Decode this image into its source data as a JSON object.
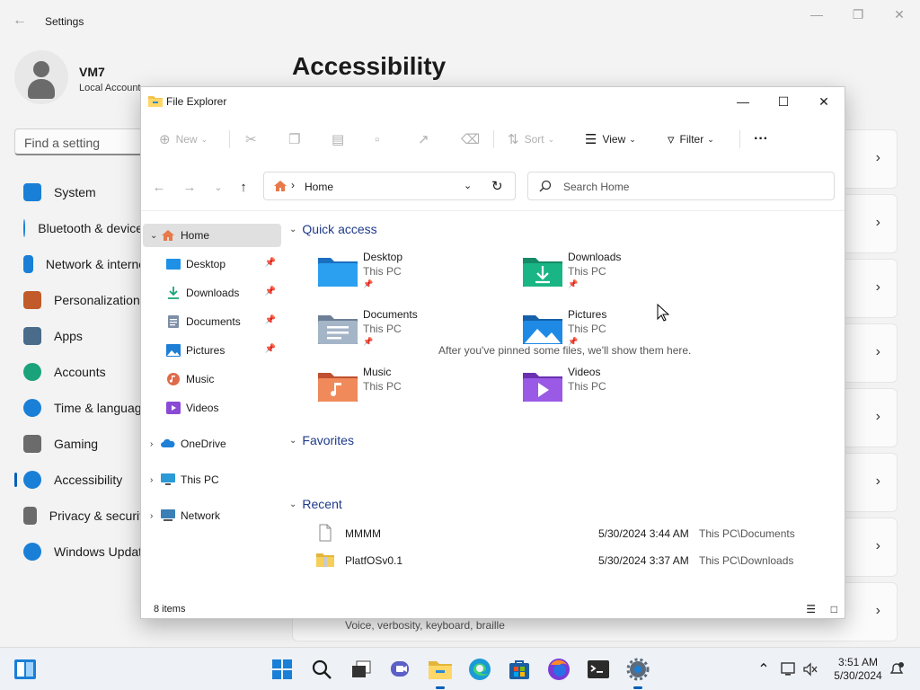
{
  "settings": {
    "title": "Settings",
    "user_name": "VM7",
    "account_type": "Local Account",
    "search_placeholder": "Find a setting",
    "heading": "Accessibility",
    "nav": [
      {
        "label": "System",
        "color": "#1a7fd6"
      },
      {
        "label": "Bluetooth & devices",
        "color": "#1a7fd6"
      },
      {
        "label": "Network & internet",
        "color": "#1a7fd6"
      },
      {
        "label": "Personalization",
        "color": "#c15b2a"
      },
      {
        "label": "Apps",
        "color": "#4a6b8a"
      },
      {
        "label": "Accounts",
        "color": "#1aa37a"
      },
      {
        "label": "Time & language",
        "color": "#1a7fd6"
      },
      {
        "label": "Gaming",
        "color": "#6b6b6b"
      },
      {
        "label": "Accessibility",
        "color": "#1a7fd6"
      },
      {
        "label": "Privacy & security",
        "color": "#6b6b6b"
      },
      {
        "label": "Windows Update",
        "color": "#1a7fd6"
      }
    ],
    "card_last_subtitle": "Voice, verbosity, keyboard, braille"
  },
  "explorer": {
    "title": "File Explorer",
    "toolbar": {
      "new": "New",
      "sort": "Sort",
      "view": "View",
      "filter": "Filter",
      "more": "···"
    },
    "address": "Home",
    "search_placeholder": "Search Home",
    "sidebar": [
      {
        "label": "Home",
        "icon": "home-icon",
        "pinned": false
      },
      {
        "label": "Desktop",
        "icon": "desktop-folder-icon",
        "pinned": true
      },
      {
        "label": "Downloads",
        "icon": "downloads-folder-icon",
        "pinned": true
      },
      {
        "label": "Documents",
        "icon": "documents-folder-icon",
        "pinned": true
      },
      {
        "label": "Pictures",
        "icon": "pictures-folder-icon",
        "pinned": true
      },
      {
        "label": "Music",
        "icon": "music-folder-icon",
        "pinned": false
      },
      {
        "label": "Videos",
        "icon": "videos-folder-icon",
        "pinned": false
      },
      {
        "label": "OneDrive",
        "icon": "onedrive-icon",
        "pinned": false
      },
      {
        "label": "This PC",
        "icon": "this-pc-icon",
        "pinned": false
      },
      {
        "label": "Network",
        "icon": "network-icon",
        "pinned": false
      }
    ],
    "sections": {
      "quick_access": "Quick access",
      "favorites": "Favorites",
      "recent": "Recent"
    },
    "quick_access": [
      {
        "name": "Desktop",
        "location": "This PC",
        "pinned": true,
        "color": "#1e90e6"
      },
      {
        "name": "Downloads",
        "location": "This PC",
        "pinned": true,
        "color": "#1aa37a"
      },
      {
        "name": "Documents",
        "location": "This PC",
        "pinned": true,
        "color": "#7d8fa6"
      },
      {
        "name": "Pictures",
        "location": "This PC",
        "pinned": true,
        "color": "#1e7fd6"
      },
      {
        "name": "Music",
        "location": "This PC",
        "pinned": false,
        "color": "#e06a4a"
      },
      {
        "name": "Videos",
        "location": "This PC",
        "pinned": false,
        "color": "#8a4ad6"
      }
    ],
    "favorites_empty": "After you've pinned some files, we'll show them here.",
    "recent": [
      {
        "name": "MMMM",
        "date": "5/30/2024 3:44 AM",
        "path": "This PC\\Documents",
        "icon": "file-icon"
      },
      {
        "name": "PlatfOSv0.1",
        "date": "5/30/2024 3:37 AM",
        "path": "This PC\\Downloads",
        "icon": "zip-folder-icon"
      }
    ],
    "status": "8 items"
  },
  "taskbar": {
    "time": "3:51 AM",
    "date": "5/30/2024"
  }
}
